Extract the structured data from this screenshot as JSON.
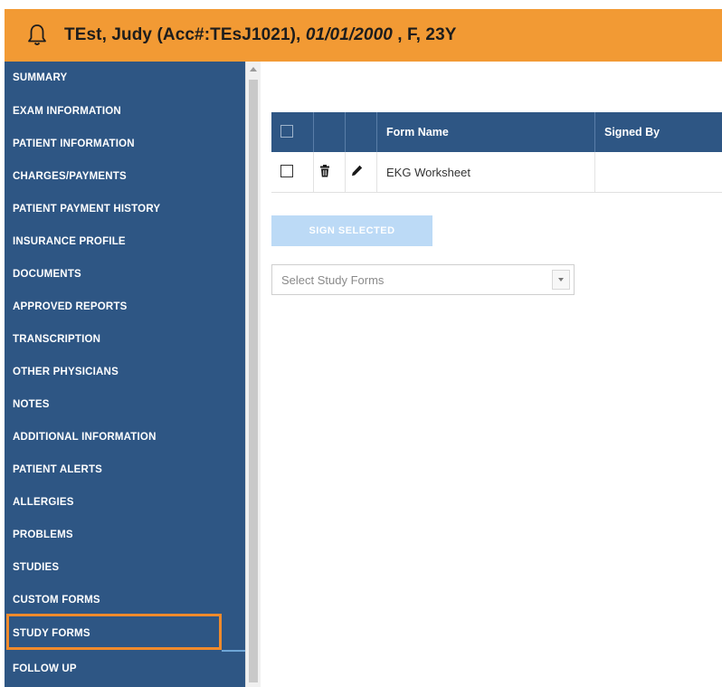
{
  "header": {
    "icon": "bell-icon",
    "patient_prefix": "TEst, Judy (Acc#:TEsJ1021),",
    "patient_dob": "01/01/2000",
    "patient_suffix": ", F, 23Y"
  },
  "sidebar": {
    "items": [
      {
        "label": "SUMMARY"
      },
      {
        "label": "EXAM INFORMATION"
      },
      {
        "label": "PATIENT INFORMATION"
      },
      {
        "label": "CHARGES/PAYMENTS"
      },
      {
        "label": "PATIENT PAYMENT HISTORY"
      },
      {
        "label": "INSURANCE PROFILE"
      },
      {
        "label": "DOCUMENTS"
      },
      {
        "label": "APPROVED REPORTS"
      },
      {
        "label": "TRANSCRIPTION"
      },
      {
        "label": "OTHER PHYSICIANS"
      },
      {
        "label": "NOTES"
      },
      {
        "label": "ADDITIONAL INFORMATION"
      },
      {
        "label": "PATIENT ALERTS"
      },
      {
        "label": "ALLERGIES"
      },
      {
        "label": "PROBLEMS"
      },
      {
        "label": "STUDIES"
      },
      {
        "label": "CUSTOM FORMS"
      },
      {
        "label": "STUDY FORMS"
      },
      {
        "label": "FOLLOW UP"
      }
    ],
    "active_item": "STUDY FORMS"
  },
  "table": {
    "columns": [
      "Form Name",
      "Signed By"
    ],
    "rows": [
      {
        "form_name": "EKG Worksheet",
        "signed_by": ""
      }
    ]
  },
  "sign_button": {
    "label": "SIGN SELECTED"
  },
  "study_forms_select": {
    "placeholder": "Select Study Forms"
  },
  "colors": {
    "header_bg": "#f29a34",
    "sidebar_bg": "#2e5684",
    "highlight": "#f08a2b",
    "button_bg": "#bcdaf6"
  }
}
